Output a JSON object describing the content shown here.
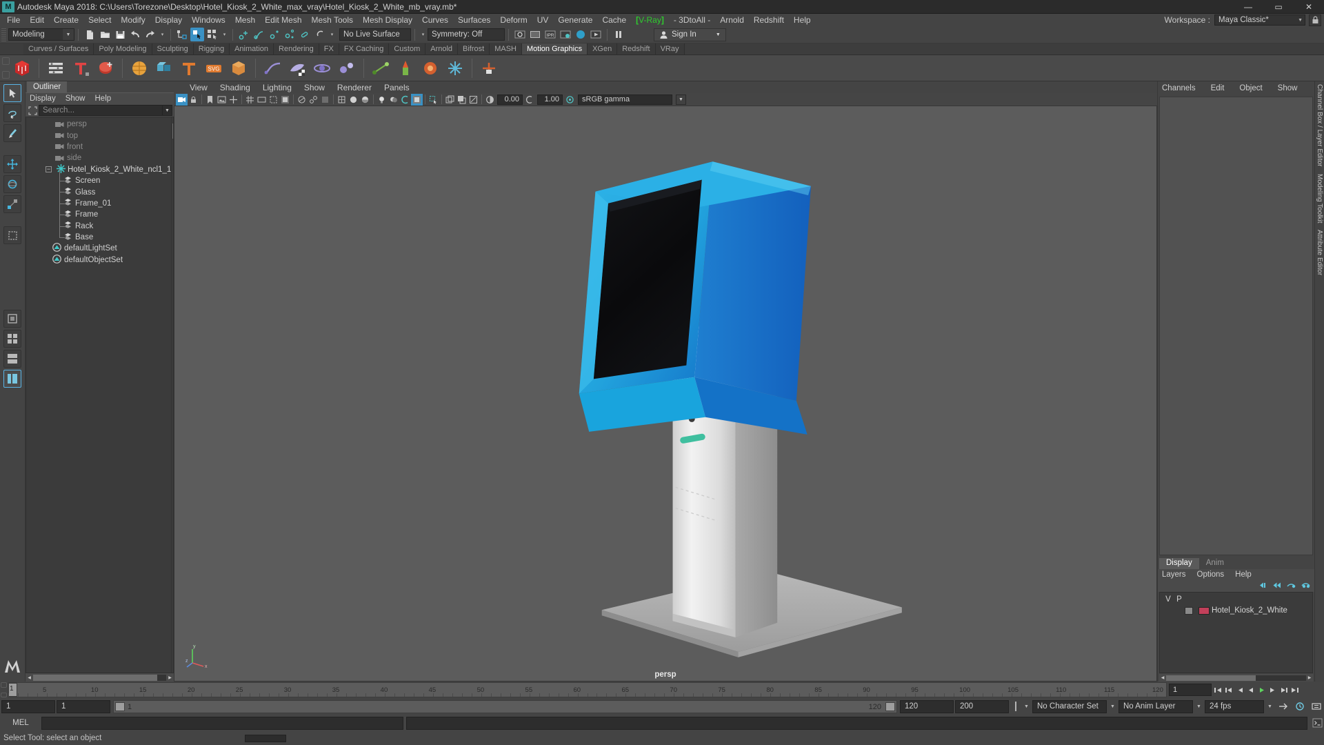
{
  "titlebar": {
    "logo": "M",
    "title": "Autodesk Maya 2018: C:\\Users\\Torezone\\Desktop\\Hotel_Kiosk_2_White_max_vray\\Hotel_Kiosk_2_White_mb_vray.mb*",
    "minimize": "—",
    "maximize": "▭",
    "close": "✕"
  },
  "menubar": {
    "items": [
      {
        "label": "File"
      },
      {
        "label": "Edit"
      },
      {
        "label": "Create"
      },
      {
        "label": "Select"
      },
      {
        "label": "Modify"
      },
      {
        "label": "Display"
      },
      {
        "label": "Windows"
      },
      {
        "label": "Mesh"
      },
      {
        "label": "Edit Mesh"
      },
      {
        "label": "Mesh Tools"
      },
      {
        "label": "Mesh Display"
      },
      {
        "label": "Curves"
      },
      {
        "label": "Surfaces"
      },
      {
        "label": "Deform"
      },
      {
        "label": "UV"
      },
      {
        "label": "Generate"
      },
      {
        "label": "Cache"
      },
      {
        "label": "V-Ray",
        "style": "vray"
      },
      {
        "label": "- 3DtoAll -"
      },
      {
        "label": "Arnold"
      },
      {
        "label": "Redshift"
      },
      {
        "label": "Help"
      }
    ],
    "workspace_label": "Workspace :",
    "workspace_value": "Maya Classic*",
    "lock_icon": "lock-icon"
  },
  "statusline": {
    "menuset": "Modeling",
    "live_surface": "No Live Surface",
    "symmetry": "Symmetry: Off",
    "signin": "Sign In",
    "icons": [
      "new-scene-icon",
      "open-scene-icon",
      "save-scene-icon",
      "undo-icon",
      "redo-icon",
      "select-hierarchy-icon",
      "select-object-icon",
      "select-component-icon",
      "snap-grid-icon",
      "snap-curve-icon",
      "snap-point-icon",
      "snap-projected-icon",
      "snap-view-plane-icon",
      "make-live-icon",
      "render-view-icon",
      "render-current-frame-icon",
      "ipr-icon",
      "render-settings-icon",
      "hypershade-icon",
      "render-sequence-icon"
    ]
  },
  "shelf": {
    "tabs": [
      {
        "label": "Curves / Surfaces",
        "active": false
      },
      {
        "label": "Poly Modeling",
        "active": false
      },
      {
        "label": "Sculpting",
        "active": false
      },
      {
        "label": "Rigging",
        "active": false
      },
      {
        "label": "Animation",
        "active": false
      },
      {
        "label": "Rendering",
        "active": false
      },
      {
        "label": "FX",
        "active": false
      },
      {
        "label": "FX Caching",
        "active": false
      },
      {
        "label": "Custom",
        "active": false
      },
      {
        "label": "Arnold",
        "active": false
      },
      {
        "label": "Bifrost",
        "active": false
      },
      {
        "label": "MASH",
        "active": false
      },
      {
        "label": "Motion Graphics",
        "active": true
      },
      {
        "label": "XGen",
        "active": false
      },
      {
        "label": "Redshift",
        "active": false
      },
      {
        "label": "VRay",
        "active": false
      }
    ],
    "icons": [
      "mash-network-icon",
      "mash-menu-icon",
      "mash-text-icon",
      "mash-add-node-icon",
      "mash-repro-icon",
      "mash-instancer-icon",
      "mash-type-icon",
      "mash-svg-icon",
      "mash-cache-icon",
      "mash-curve-icon",
      "mash-color-icon",
      "mash-orbit-icon",
      "mash-dynamics-icon",
      "mash-trails-icon",
      "mash-flight-icon",
      "mash-merge-icon",
      "mash-signal-icon",
      "mash-spring-icon",
      "mash-placer-icon"
    ]
  },
  "toolbox": {
    "items": [
      {
        "name": "select-tool",
        "selected": true
      },
      {
        "name": "lasso-select-tool",
        "selected": false
      },
      {
        "name": "paint-select-tool",
        "selected": false
      },
      {
        "name": "move-tool",
        "selected": false
      },
      {
        "name": "rotate-tool",
        "selected": false
      },
      {
        "name": "scale-tool",
        "selected": false
      },
      {
        "name": "last-tool",
        "selected": false
      },
      {
        "name": "single-view-layout",
        "selected": false
      },
      {
        "name": "four-view-layout",
        "selected": false
      },
      {
        "name": "persp-outliner-layout",
        "selected": true
      }
    ],
    "logo": "M"
  },
  "outliner": {
    "tab": "Outliner",
    "menus": [
      "Display",
      "Show",
      "Help"
    ],
    "search_placeholder": "Search...",
    "pick_icon": "pick-walk-icon",
    "items": [
      {
        "label": "persp",
        "type": "camera",
        "dim": true
      },
      {
        "label": "top",
        "type": "camera",
        "dim": true
      },
      {
        "label": "front",
        "type": "camera",
        "dim": true
      },
      {
        "label": "side",
        "type": "camera",
        "dim": true
      },
      {
        "label": "Hotel_Kiosk_2_White_ncl1_1",
        "type": "group",
        "expanded": true
      },
      {
        "label": "Screen",
        "type": "mesh"
      },
      {
        "label": "Glass",
        "type": "mesh"
      },
      {
        "label": "Frame_01",
        "type": "mesh"
      },
      {
        "label": "Frame",
        "type": "mesh"
      },
      {
        "label": "Rack",
        "type": "mesh"
      },
      {
        "label": "Base",
        "type": "mesh"
      },
      {
        "label": "defaultLightSet",
        "type": "set"
      },
      {
        "label": "defaultObjectSet",
        "type": "set"
      }
    ]
  },
  "viewport": {
    "menus": [
      "View",
      "Shading",
      "Lighting",
      "Show",
      "Renderer",
      "Panels"
    ],
    "camera_label": "persp",
    "exposure": "0.00",
    "gamma_value": "1.00",
    "color_management": "sRGB gamma",
    "toolbar_icons": [
      "select-camera-icon",
      "lock-camera-icon",
      "bookmark-icon",
      "image-plane-icon",
      "2d-pan-zoom-icon",
      "grid-icon",
      "film-gate-icon",
      "resolution-gate-icon",
      "gate-mask-icon",
      "xray-icon",
      "xray-joints-icon",
      "xray-active-icon",
      "wireframe-icon",
      "smooth-shade-icon",
      "smooth-shade-textured-icon",
      "use-all-lights-icon",
      "shadows-icon",
      "ao-icon",
      "motion-blur-icon",
      "multisample-icon",
      "depth-of-field-icon",
      "isolate-select-icon",
      "grid-toggle-icon",
      "film-gate-toggle-icon",
      "resolution-gate-toggle-icon",
      "exposure-icon",
      "gamma-icon",
      "view-transform-icon"
    ],
    "axis_labels": {
      "x": "x",
      "y": "y",
      "z": "z"
    }
  },
  "right_panel": {
    "tabs": [
      "Channels",
      "Edit",
      "Object",
      "Show"
    ],
    "vertical_tabs": [
      "Channel Box / Layer Editor",
      "Modeling Toolkit",
      "Attribute Editor"
    ]
  },
  "layer_editor": {
    "tabs": [
      {
        "label": "Display",
        "active": true
      },
      {
        "label": "Anim",
        "active": false
      }
    ],
    "menus": [
      "Layers",
      "Options",
      "Help"
    ],
    "icons": [
      "layer-prev-icon",
      "layer-rewind-icon",
      "layer-new-icon",
      "layer-new-from-selected-icon"
    ],
    "columns": [
      "V",
      "P"
    ],
    "layers": [
      {
        "v": "",
        "p": "",
        "color": "#c2405a",
        "name": "Hotel_Kiosk_2_White"
      }
    ]
  },
  "timeslider": {
    "current_frame": "1",
    "ticks": [
      "5",
      "10",
      "15",
      "20",
      "25",
      "30",
      "35",
      "40",
      "45",
      "50",
      "55",
      "60",
      "65",
      "70",
      "75",
      "80",
      "85",
      "90",
      "95",
      "100",
      "105",
      "110",
      "115",
      "120"
    ],
    "field_value": "1",
    "playback_icons": [
      "go-to-start-icon",
      "step-back-frame-icon",
      "step-back-key-icon",
      "play-backwards-icon",
      "play-forwards-icon",
      "step-forward-key-icon",
      "step-forward-frame-icon",
      "go-to-end-icon"
    ]
  },
  "range_slider": {
    "start": "1",
    "anim_start": "1",
    "bar_left_value": "1",
    "bar_right_value": "120",
    "anim_end": "120",
    "end": "200",
    "character_set": "No Character Set",
    "anim_layer": "No Anim Layer",
    "fps": "24 fps",
    "auto_key_icon": "auto-key-icon",
    "anim_prefs_icon": "animation-preferences-icon"
  },
  "command_line": {
    "label": "MEL",
    "input_value": "",
    "output_value": "",
    "script_editor_icon": "script-editor-icon"
  },
  "help_line": {
    "text": "Select Tool: select an object"
  },
  "colors": {
    "accent_blue": "#3a91c4",
    "vray_green": "#2ecc2e",
    "layer_red": "#c2405a",
    "bg_dark": "#444444",
    "viewport_bg": "#5c5c5c",
    "kiosk_blue": "#1a9ad6",
    "kiosk_blue_dark": "#1668c8",
    "kiosk_white": "#e8e8e8",
    "kiosk_screen": "#0b0b0c",
    "kiosk_accent": "#3fbf9f"
  }
}
